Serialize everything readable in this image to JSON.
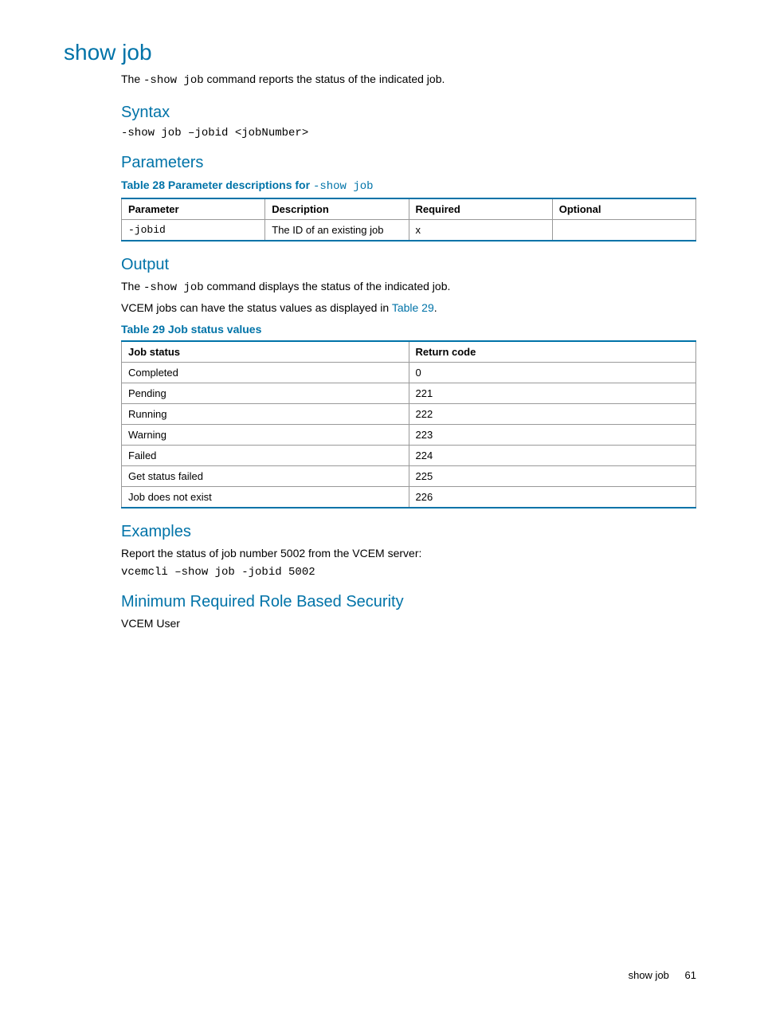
{
  "main_title": "show job",
  "intro": {
    "pre_cmd": "The ",
    "cmd": "-show job",
    "post_cmd": " command reports the status of the indicated job."
  },
  "syntax": {
    "heading": "Syntax",
    "code": "-show job –jobid <jobNumber>"
  },
  "parameters": {
    "heading": "Parameters",
    "table_title_lead": "Table 28 Parameter descriptions for ",
    "table_title_cmd": "-show job",
    "headers": {
      "param": "Parameter",
      "desc": "Description",
      "req": "Required",
      "opt": "Optional"
    },
    "rows": [
      {
        "param": "-jobid",
        "desc": "The ID of an existing job",
        "req": "x",
        "opt": ""
      }
    ]
  },
  "output": {
    "heading": "Output",
    "line1": {
      "pre_cmd": "The ",
      "cmd": "-show job",
      "post_cmd": " command displays the status of the indicated job."
    },
    "line2_pre": "VCEM jobs can have the status values as displayed in ",
    "line2_link": "Table 29",
    "line2_post": ".",
    "table_title": "Table 29 Job status values",
    "headers": {
      "status": "Job status",
      "code": "Return code"
    },
    "chart_data": {
      "type": "table",
      "columns": [
        "Job status",
        "Return code"
      ],
      "rows": [
        [
          "Completed",
          "0"
        ],
        [
          "Pending",
          "221"
        ],
        [
          "Running",
          "222"
        ],
        [
          "Warning",
          "223"
        ],
        [
          "Failed",
          "224"
        ],
        [
          "Get status failed",
          "225"
        ],
        [
          "Job does not exist",
          "226"
        ]
      ]
    }
  },
  "examples": {
    "heading": "Examples",
    "line": "Report the status of job number 5002 from the VCEM server:",
    "code": "vcemcli –show job -jobid 5002"
  },
  "security": {
    "heading": "Minimum Required Role Based Security",
    "line": "VCEM User"
  },
  "footer": {
    "label": "show job",
    "page": "61"
  }
}
